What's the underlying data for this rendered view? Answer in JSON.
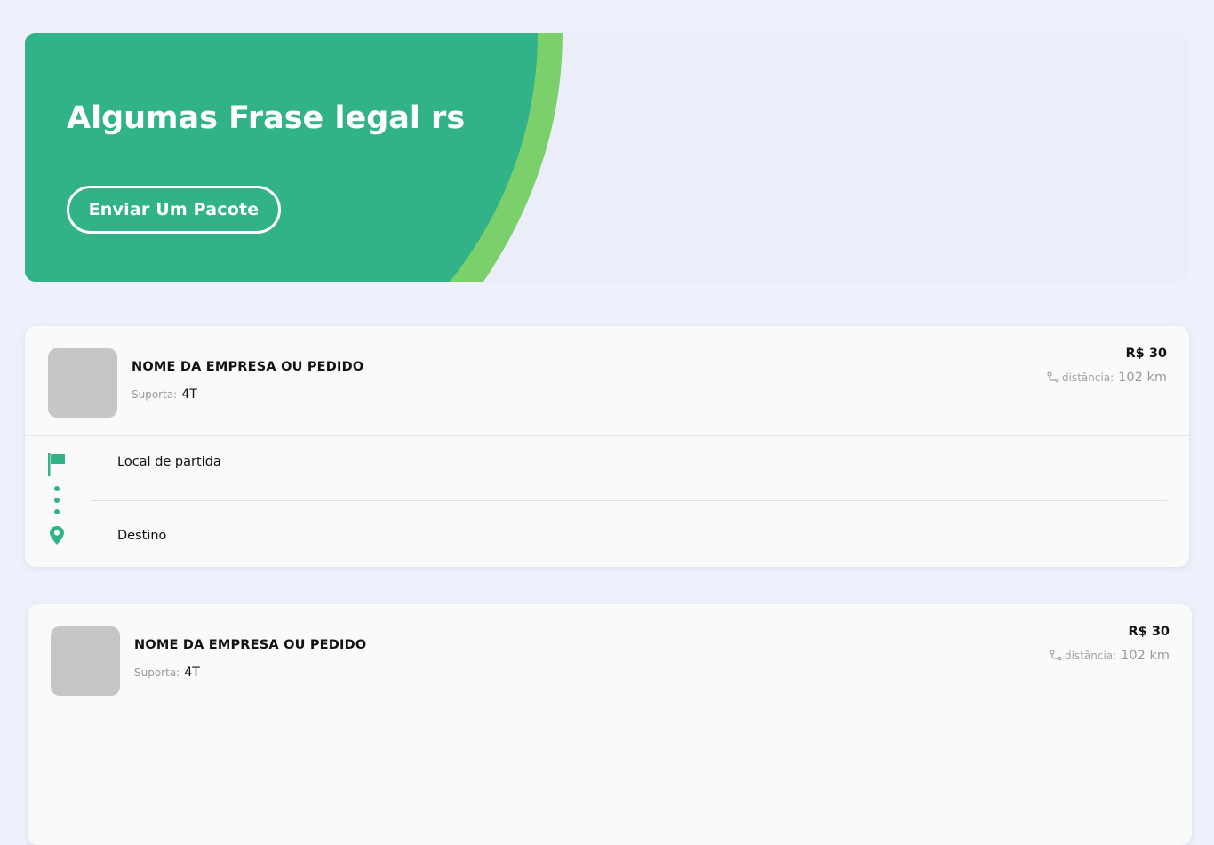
{
  "hero": {
    "title": "Algumas Frase legal rs",
    "button_label": "Enviar Um Pacote"
  },
  "colors": {
    "brand_green": "#31b289",
    "accent_light_green": "#7bd06b",
    "page_background": "#eef1fb",
    "card_background": "#fafafa",
    "thumbnail_placeholder": "#c6c6c6"
  },
  "orders": [
    {
      "name": "NOME DA EMPRESA OU PEDIDO",
      "support_label": "Suporta:",
      "support_value": "4T",
      "price": "R$ 30",
      "distance_label": "distância:",
      "distance_value": "102 km",
      "origin": "Local de partida",
      "destination": "Destino",
      "icons": {
        "distance": "route-icon",
        "origin": "flag-icon",
        "path": "dots-icon",
        "destination": "map-pin-icon"
      }
    },
    {
      "name": "NOME DA EMPRESA OU PEDIDO",
      "support_label": "Suporta:",
      "support_value": "4T",
      "price": "R$ 30",
      "distance_label": "distância:",
      "distance_value": "102 km"
    }
  ]
}
